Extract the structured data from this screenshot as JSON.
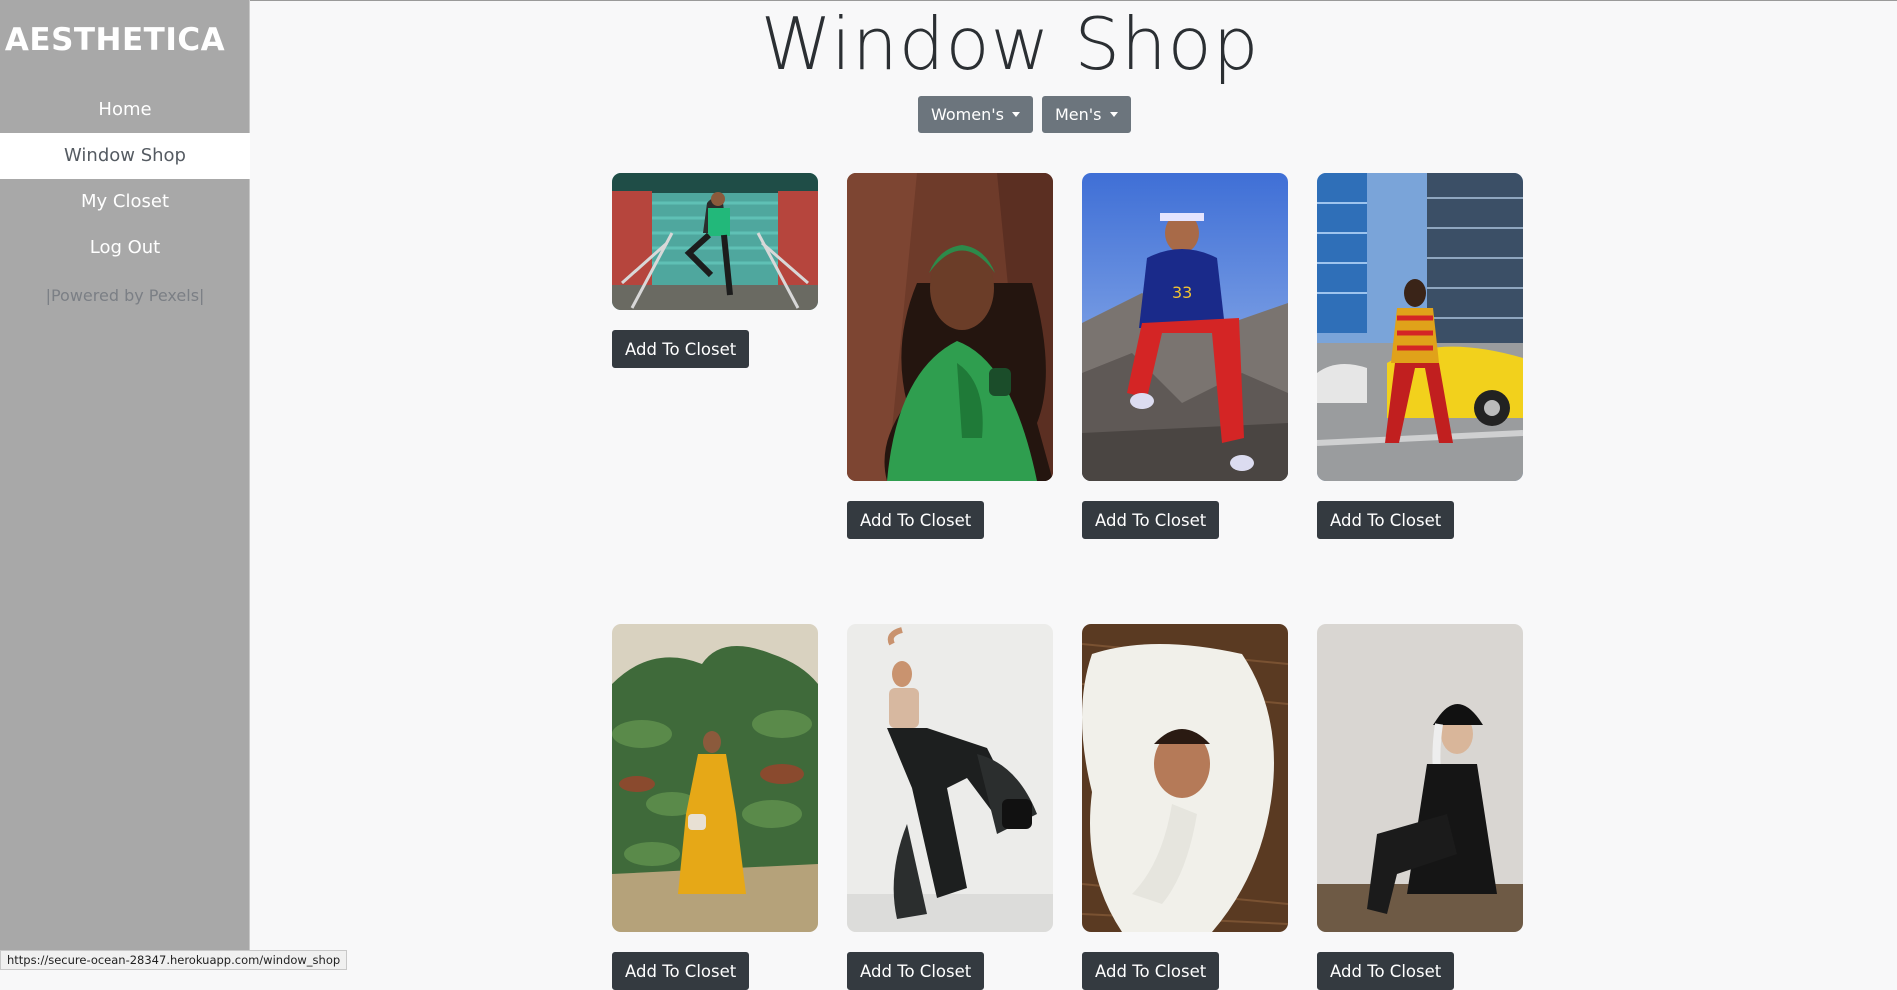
{
  "brand": "AESTHETICA",
  "nav": [
    "Home",
    "Window Shop",
    "My Closet",
    "Log Out"
  ],
  "nav_active_index": 1,
  "powered_by": "|Powered by Pexels|",
  "page_title": "Window Shop",
  "filters": {
    "womens": "Women's",
    "mens": "Men's"
  },
  "add_label": "Add To Closet",
  "status_url": "https://secure-ocean-28347.herokuapp.com/window_shop",
  "colors": {
    "sidebar": "#a8a8a8",
    "button_dark": "#343a40",
    "button_gray": "#6c757d",
    "page_bg": "#f8f8f9"
  }
}
